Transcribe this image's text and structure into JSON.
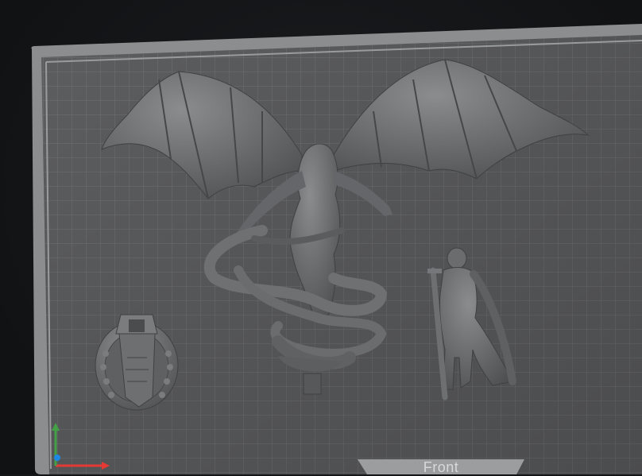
{
  "viewport": {
    "plate_label": "Front",
    "colors": {
      "background": "#141618",
      "plate_frame": "#8c8d8f",
      "plate_surface": "#5c5d5f",
      "grid_line": "#707173",
      "model": "#6a6c6e",
      "axis_x": "#e53935",
      "axis_y": "#43a047",
      "axis_z": "#1e88e5"
    }
  },
  "models": [
    {
      "name": "winged-demon-miniature"
    },
    {
      "name": "knight-miniature"
    },
    {
      "name": "round-base-with-pillar"
    }
  ],
  "gizmo": {
    "axes": [
      "x",
      "y",
      "z"
    ]
  }
}
